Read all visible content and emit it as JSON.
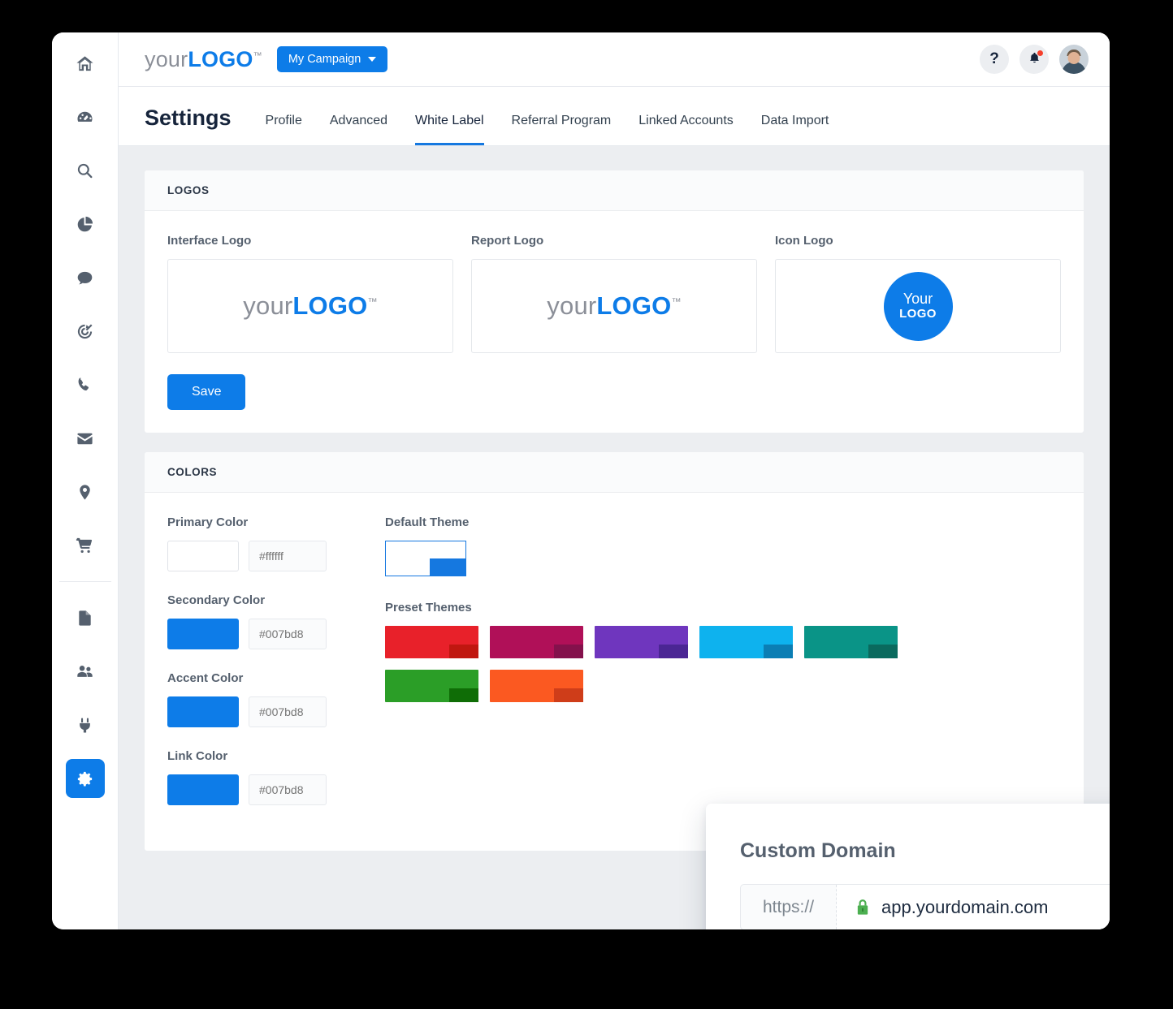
{
  "sidebar": {
    "items": [
      {
        "name": "home",
        "icon": "home-icon",
        "active": false
      },
      {
        "name": "dashboard",
        "icon": "gauge-icon",
        "active": false
      },
      {
        "name": "search",
        "icon": "search-icon",
        "active": false
      },
      {
        "name": "reports",
        "icon": "pie-chart-icon",
        "active": false
      },
      {
        "name": "messages",
        "icon": "comment-icon",
        "active": false
      },
      {
        "name": "goals",
        "icon": "target-icon",
        "active": false
      },
      {
        "name": "calls",
        "icon": "phone-icon",
        "active": false
      },
      {
        "name": "email",
        "icon": "envelope-icon",
        "active": false
      },
      {
        "name": "locations",
        "icon": "map-pin-icon",
        "active": false
      },
      {
        "name": "commerce",
        "icon": "shopping-cart-icon",
        "active": false
      },
      {
        "name": "documents",
        "icon": "document-icon",
        "active": false
      },
      {
        "name": "contacts",
        "icon": "users-icon",
        "active": false
      },
      {
        "name": "integrations",
        "icon": "plug-icon",
        "active": false
      },
      {
        "name": "settings",
        "icon": "gear-icon",
        "active": true
      }
    ]
  },
  "topbar": {
    "brand_prefix": "your",
    "brand_bold": "LOGO",
    "brand_tm": "™",
    "campaign_label": "My Campaign",
    "help_label": "?",
    "has_notification": true
  },
  "header": {
    "title": "Settings",
    "tabs": [
      {
        "label": "Profile",
        "active": false
      },
      {
        "label": "Advanced",
        "active": false
      },
      {
        "label": "White Label",
        "active": true
      },
      {
        "label": "Referral Program",
        "active": false
      },
      {
        "label": "Linked Accounts",
        "active": false
      },
      {
        "label": "Data Import",
        "active": false
      }
    ]
  },
  "logos_panel": {
    "heading": "LOGOS",
    "interface_logo": {
      "label": "Interface Logo",
      "prefix": "your",
      "bold": "LOGO",
      "tm": "™"
    },
    "report_logo": {
      "label": "Report Logo",
      "prefix": "your",
      "bold": "LOGO",
      "tm": "™"
    },
    "icon_logo": {
      "label": "Icon Logo",
      "line1": "Your",
      "line2": "LOGO",
      "circle_color": "#0d7ce8"
    },
    "save_label": "Save"
  },
  "colors_panel": {
    "heading": "COLORS",
    "fields": [
      {
        "label": "Primary Color",
        "swatch": "#ffffff",
        "hex_placeholder": "#ffffff"
      },
      {
        "label": "Secondary Color",
        "swatch": "#0d7ce8",
        "hex_placeholder": "#007bd8"
      },
      {
        "label": "Accent Color",
        "swatch": "#0d7ce8",
        "hex_placeholder": "#007bd8"
      },
      {
        "label": "Link Color",
        "swatch": "#0d7ce8",
        "hex_placeholder": "#007bd8"
      }
    ],
    "default_theme": {
      "label": "Default Theme",
      "base": "#ffffff",
      "accent": "#1578e0",
      "border": "#1578e0"
    },
    "preset_themes": {
      "label": "Preset Themes",
      "items": [
        {
          "name": "red",
          "base": "#e8212a",
          "accent": "#c01710"
        },
        {
          "name": "magenta",
          "base": "#b01058",
          "accent": "#84114c"
        },
        {
          "name": "purple",
          "base": "#6f36be",
          "accent": "#4b2694"
        },
        {
          "name": "cyan",
          "base": "#0eb2ee",
          "accent": "#0b7eb4"
        },
        {
          "name": "teal",
          "base": "#0a9487",
          "accent": "#0a6a5e"
        },
        {
          "name": "green",
          "base": "#2b9e27",
          "accent": "#0f6d06"
        },
        {
          "name": "orange",
          "base": "#fb5921",
          "accent": "#cf3d19"
        }
      ]
    }
  },
  "custom_domain": {
    "title": "Custom Domain",
    "protocol": "https://",
    "value": "app.yourdomain.com",
    "lock_color": "#4caf50"
  }
}
